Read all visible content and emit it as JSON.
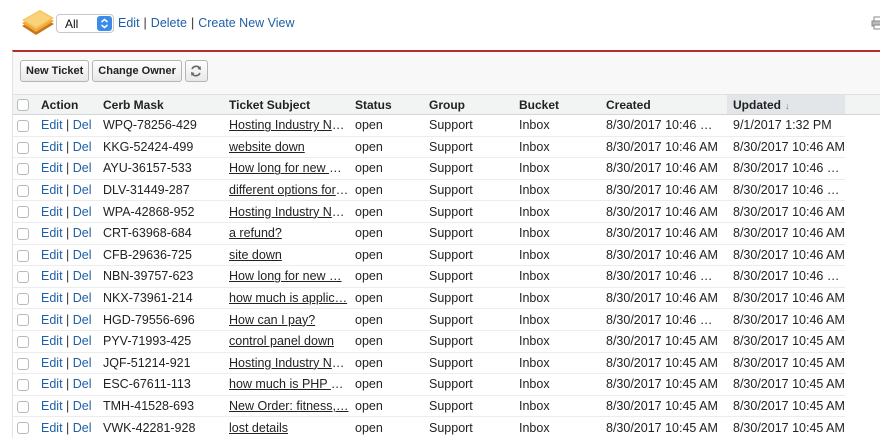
{
  "view": {
    "selected": "All",
    "links": [
      "Edit",
      "Delete",
      "Create New View"
    ],
    "separator": "|"
  },
  "toolbar": {
    "new_ticket": "New Ticket",
    "change_owner": "Change Owner"
  },
  "table": {
    "columns": [
      "Action",
      "Cerb Mask",
      "Ticket Subject",
      "Status",
      "Group",
      "Bucket",
      "Created",
      "Updated"
    ],
    "action_edit": "Edit",
    "action_sep": "|",
    "action_del": "Del",
    "rows": [
      {
        "mask": "WPQ-78256-429",
        "subject": "Hosting Industry Ne…",
        "status": "open",
        "group": "Support",
        "bucket": "Inbox",
        "created": "8/30/2017 10:46 …",
        "updated": "9/1/2017 1:32 PM"
      },
      {
        "mask": "KKG-52424-499",
        "subject": "website down",
        "status": "open",
        "group": "Support",
        "bucket": "Inbox",
        "created": "8/30/2017 10:46 AM",
        "updated": "8/30/2017 10:46 AM"
      },
      {
        "mask": "AYU-36157-533",
        "subject": "How long for new U…",
        "status": "open",
        "group": "Support",
        "bucket": "Inbox",
        "created": "8/30/2017 10:46 AM",
        "updated": "8/30/2017 10:46 …"
      },
      {
        "mask": "DLV-31449-287",
        "subject": "different options for …",
        "status": "open",
        "group": "Support",
        "bucket": "Inbox",
        "created": "8/30/2017 10:46 AM",
        "updated": "8/30/2017 10:46 …"
      },
      {
        "mask": "WPA-42868-952",
        "subject": "Hosting Industry Ne…",
        "status": "open",
        "group": "Support",
        "bucket": "Inbox",
        "created": "8/30/2017 10:46 AM",
        "updated": "8/30/2017 10:46 AM"
      },
      {
        "mask": "CRT-63968-684",
        "subject": "a refund?",
        "status": "open",
        "group": "Support",
        "bucket": "Inbox",
        "created": "8/30/2017 10:46 AM",
        "updated": "8/30/2017 10:46 AM"
      },
      {
        "mask": "CFB-29636-725",
        "subject": "site down",
        "status": "open",
        "group": "Support",
        "bucket": "Inbox",
        "created": "8/30/2017 10:46 AM",
        "updated": "8/30/2017 10:46 AM"
      },
      {
        "mask": "NBN-39757-623",
        "subject": "How long for new …",
        "status": "open",
        "group": "Support",
        "bucket": "Inbox",
        "created": "8/30/2017 10:46 …",
        "updated": "8/30/2017 10:46 …"
      },
      {
        "mask": "NKX-73961-214",
        "subject": "how much is applic…",
        "status": "open",
        "group": "Support",
        "bucket": "Inbox",
        "created": "8/30/2017 10:46 AM",
        "updated": "8/30/2017 10:46 AM"
      },
      {
        "mask": "HGD-79556-696",
        "subject": "How can I pay?",
        "status": "open",
        "group": "Support",
        "bucket": "Inbox",
        "created": "8/30/2017 10:46 …",
        "updated": "8/30/2017 10:46 AM"
      },
      {
        "mask": "PYV-71993-425",
        "subject": "control panel down",
        "status": "open",
        "group": "Support",
        "bucket": "Inbox",
        "created": "8/30/2017 10:45 AM",
        "updated": "8/30/2017 10:45 AM"
      },
      {
        "mask": "JQF-51214-921",
        "subject": "Hosting Industry Ne…",
        "status": "open",
        "group": "Support",
        "bucket": "Inbox",
        "created": "8/30/2017 10:45 AM",
        "updated": "8/30/2017 10:45 AM"
      },
      {
        "mask": "ESC-67611-113",
        "subject": "how much is PHP h…",
        "status": "open",
        "group": "Support",
        "bucket": "Inbox",
        "created": "8/30/2017 10:45 AM",
        "updated": "8/30/2017 10:45 AM"
      },
      {
        "mask": "TMH-41528-693",
        "subject": "New Order: fitness,…",
        "status": "open",
        "group": "Support",
        "bucket": "Inbox",
        "created": "8/30/2017 10:45 AM",
        "updated": "8/30/2017 10:45 AM"
      },
      {
        "mask": "VWK-42281-928",
        "subject": "lost details",
        "status": "open",
        "group": "Support",
        "bucket": "Inbox",
        "created": "8/30/2017 10:45 AM",
        "updated": "8/30/2017 10:45 AM"
      }
    ]
  },
  "icons": {
    "view_icon": "folder-stack-icon",
    "select_arrow": "chevron-updown-icon",
    "refresh": "refresh-icon",
    "print": "print-icon"
  },
  "colors": {
    "accent_bar": "#b52d2d",
    "link": "#1f5fa8",
    "select_arrow": "#3a8ce8"
  }
}
